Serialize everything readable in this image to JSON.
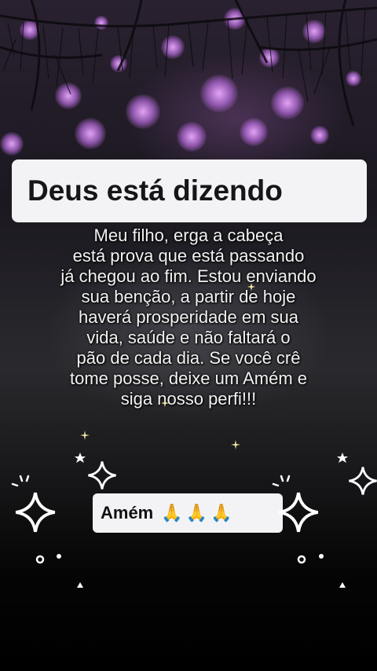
{
  "title": "Deus está dizendo",
  "message_lines": [
    "Meu filho, erga a cabeça",
    "está prova que está passando",
    "já chegou ao fim. Estou enviando",
    "sua benção, a partir de hoje",
    "haverá prosperidade em sua",
    "vida, saúde e não faltará o",
    "pão de cada dia. Se você crê",
    "tome posse, deixe um Amém e",
    "siga nosso perfi!!!"
  ],
  "amen_label": "Amém",
  "amen_icons": "🙏🙏🙏",
  "colors": {
    "bokeh": "#c98be6",
    "card_background": "#f3f3f5",
    "text": "#f2f2f2"
  },
  "decorations": [
    "sparkle-icon",
    "star-icon"
  ]
}
